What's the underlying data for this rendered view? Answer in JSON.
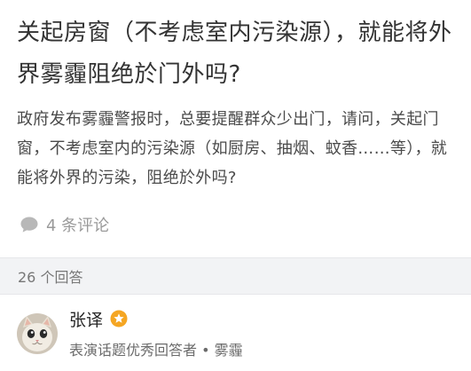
{
  "question": {
    "title": "关起房窗（不考虑室内污染源），就能将外界雾霾阻绝於门外吗?",
    "detail": "政府发布雾霾警报时，总要提醒群众少出门，请问，关起门窗，不考虑室内的污染源（如厨房、抽烟、蚊香……等），就能将外界的污染，阻绝於外吗?",
    "comments_label": "4 条评论"
  },
  "answers_header": {
    "count_label": "26 个回答"
  },
  "answer": {
    "author_name": "张译",
    "author_desc": "表演话题优秀回答者 • 雾霾",
    "badge_icon": "star-badge-icon",
    "badge_color": "#f5a623"
  },
  "icons": {
    "comment": "comment-bubble-icon",
    "avatar": "cat-avatar"
  }
}
